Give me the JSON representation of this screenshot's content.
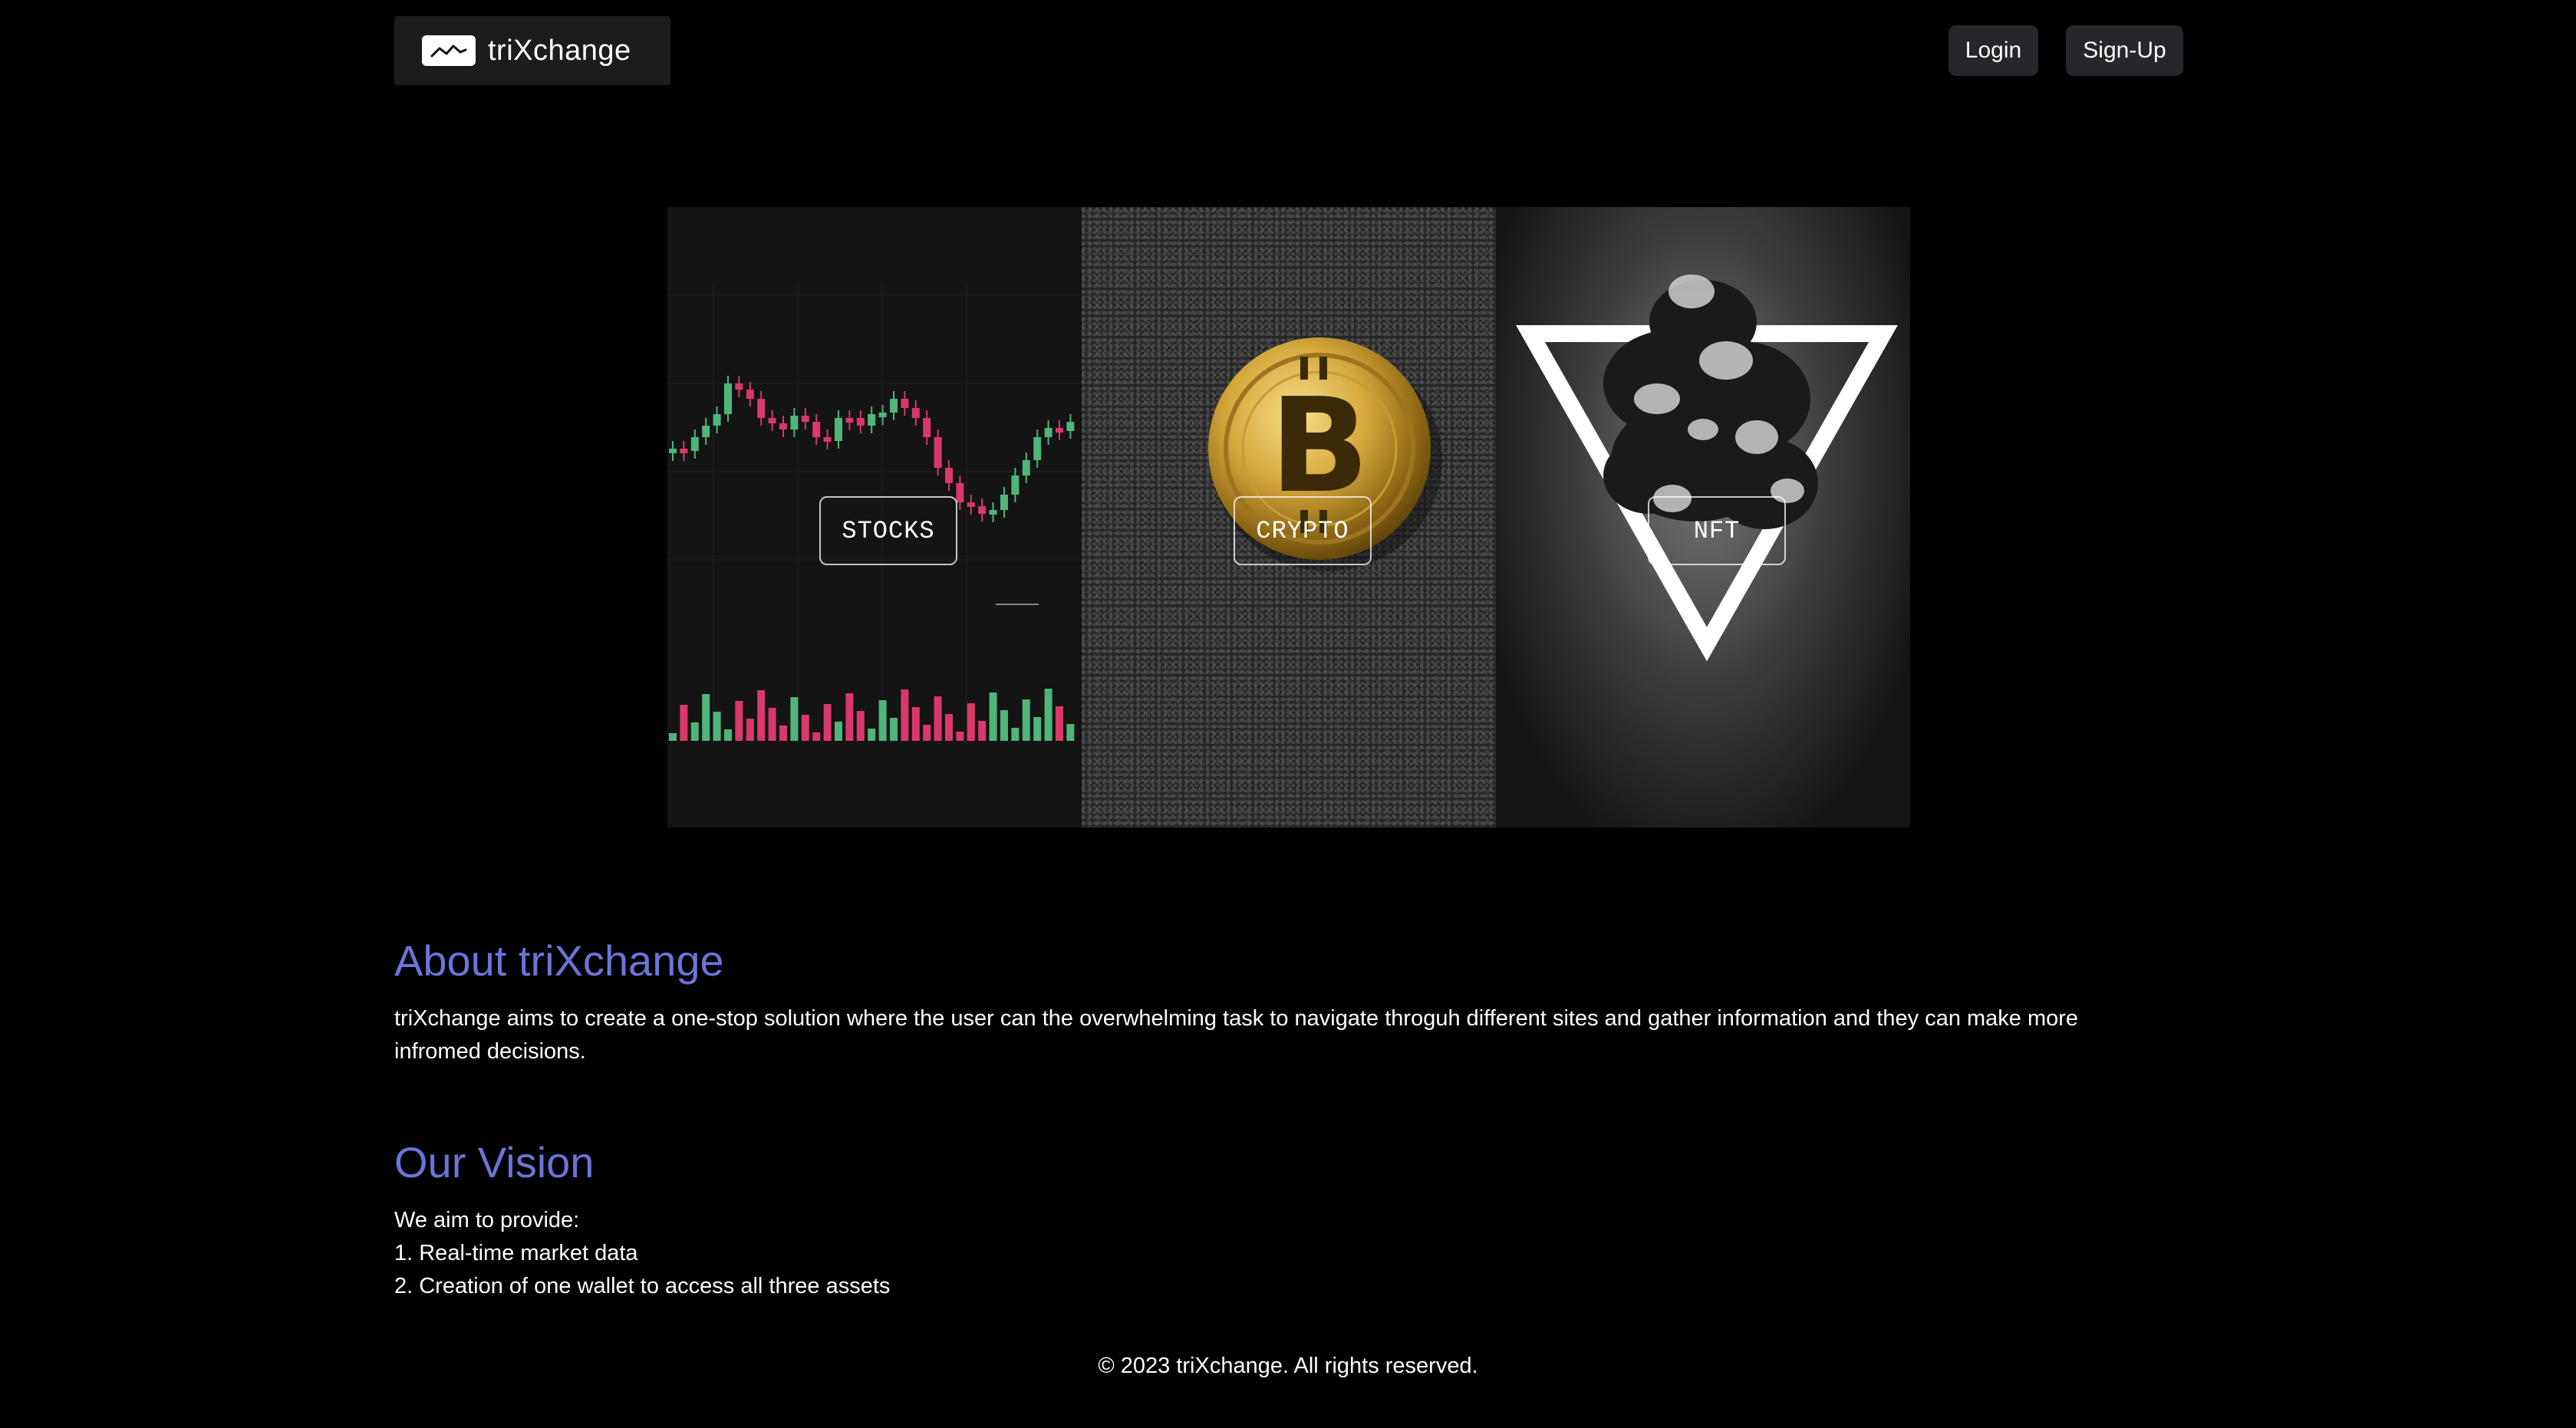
{
  "brand": {
    "name": "triXchange",
    "logo_icon": "chart-line-icon"
  },
  "nav": {
    "login_label": "Login",
    "signup_label": "Sign-Up"
  },
  "hero": {
    "panels": [
      {
        "label": "STOCKS",
        "image": "candlestick-chart-image"
      },
      {
        "label": "CRYPTO",
        "image": "bitcoin-coin-image"
      },
      {
        "label": "NFT",
        "image": "smoke-triangle-image"
      }
    ]
  },
  "about": {
    "title": "About triXchange",
    "text": "triXchange aims to create a one-stop solution where the user can the overwhelming task to navigate throguh different sites and gather information and they can make more infromed decisions."
  },
  "vision": {
    "title": "Our Vision",
    "intro": "We aim to provide:",
    "items": [
      "1. Real-time market data",
      "2. Creation of one wallet to access all three assets"
    ]
  },
  "footer": {
    "text": "© 2023 triXchange. All rights reserved."
  },
  "colors": {
    "background": "#000000",
    "heading": "#6b74d6",
    "button_bg": "#26272b",
    "candle_up": "#4fb57a",
    "candle_down": "#d9386a"
  }
}
